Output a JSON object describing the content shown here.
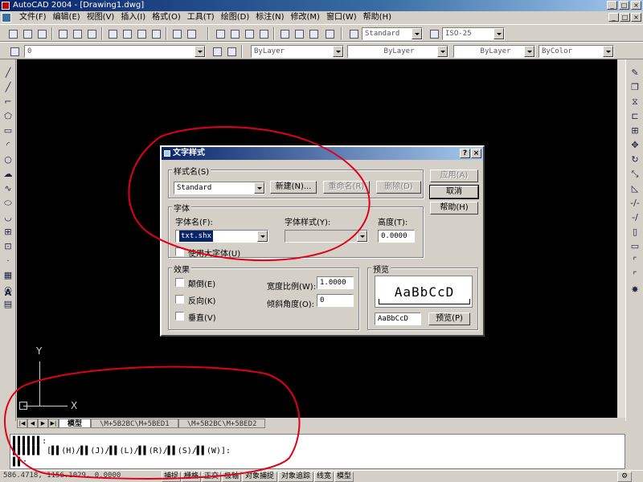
{
  "window": {
    "title": "AutoCAD 2004 - [Drawing1.dwg]",
    "controls": [
      "_",
      "□",
      "×"
    ]
  },
  "menubar": {
    "items": [
      "文件(F)",
      "编辑(E)",
      "视图(V)",
      "插入(I)",
      "格式(O)",
      "工具(T)",
      "绘图(D)",
      "标注(N)",
      "修改(M)",
      "窗口(W)",
      "帮助(H)"
    ],
    "doc_controls": [
      "_",
      "□",
      "×"
    ]
  },
  "toolbar_standard": {
    "text_style_combo": "Standard",
    "dim_style_combo": "ISO-25"
  },
  "toolbar_layers": {
    "layer_combo": "0",
    "color_combo": "ByLayer",
    "linetype_combo": "ByLayer",
    "lineweight_combo": "ByLayer",
    "plotstyle_combo": "ByColor"
  },
  "ucs": {
    "x_label": "X",
    "y_label": "Y"
  },
  "tabs": {
    "nav": [
      "|◀",
      "◀",
      "▶",
      "▶|"
    ],
    "items": [
      "模型",
      "\\M+5B2BC\\M+5BED1",
      "\\M+5B2BC\\M+5BED2"
    ]
  },
  "command": {
    "line1": "▌▌▌▌▌▌:",
    "line2": "▌▌▌▌▌▌ [▌▌(H)/▌▌(J)/▌▌(L)/▌▌(R)/▌▌(S)/▌▌(W)]:",
    "line3": "▌▌:"
  },
  "statusbar": {
    "coords": "586.4718,   1156.1029,  0.0000",
    "buttons": [
      "捕捉",
      "栅格",
      "正交",
      "极轴",
      "对象捕捉",
      "对象追踪",
      "线宽",
      "模型"
    ]
  },
  "dialog": {
    "title": "文字样式",
    "help_btn": "?",
    "close_btn": "×",
    "style_group": "样式名(S)",
    "style_value": "Standard",
    "new_btn": "新建(N)...",
    "rename_btn": "重命名(R)",
    "delete_btn": "删除(D)",
    "apply_btn": "应用(A)",
    "cancel_btn": "取消",
    "help_text_btn": "帮助(H)",
    "font_group": "字体",
    "font_name_label": "字体名(F):",
    "font_name_value": "txt.shx",
    "font_style_label": "字体样式(Y):",
    "font_style_value": "",
    "height_label": "高度(T):",
    "height_value": "0.0000",
    "bigfont_label": "使用大字体(U)",
    "effects_group": "效果",
    "upside_down_label": "颠倒(E)",
    "backwards_label": "反向(K)",
    "vertical_label": "垂直(V)",
    "width_factor_label": "宽度比例(W):",
    "width_factor_value": "1.0000",
    "oblique_label": "倾斜角度(O):",
    "oblique_value": "0",
    "preview_group": "预览",
    "preview_sample": "AaBbCcD",
    "preview_input": "AaBbCcD",
    "preview_btn": "预览(P)"
  },
  "colors": {
    "canvas": "#000000",
    "annotation": "#e0001a",
    "titlebar": "#0a246a"
  }
}
